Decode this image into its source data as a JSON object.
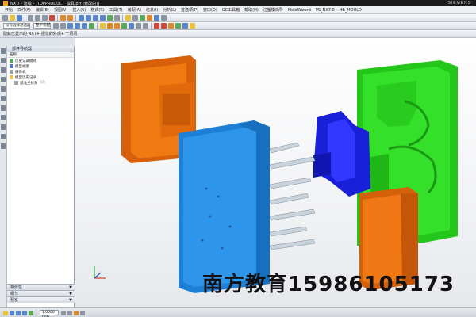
{
  "window": {
    "title": "NX 7 - 建模 - [TOPPRODUCT_模具.prt (修改的)]",
    "brand": "SIEMENS"
  },
  "menu": {
    "items": [
      "开始",
      "文件(F)",
      "编辑(E)",
      "视图(V)",
      "插入(S)",
      "格式(R)",
      "工具(T)",
      "装配(A)",
      "信息(I)",
      "分析(L)",
      "首选项(P)",
      "窗口(O)",
      "GC工具箱",
      "帮助(H)",
      "注塑模向导",
      "MoldWizard",
      "PS_NX7.0",
      "HB_MOULD"
    ]
  },
  "toolbar": {
    "filter_select": "没有选择过滤器",
    "assembly_select": "整个装配"
  },
  "breadcrumb": "隐藏已显示的 NX7+ 视觉的外观+ 一层层",
  "navigator": {
    "title": "部件导航器",
    "column_header": "名称",
    "items": [
      {
        "label": "历史记录模式",
        "level": 1,
        "icon": "history-mode-icon"
      },
      {
        "label": "模型视图",
        "level": 1,
        "icon": "model-views-icon"
      },
      {
        "label": "摄像机",
        "level": 1,
        "icon": "camera-icon"
      },
      {
        "label": "模型历史记录",
        "level": 1,
        "icon": "folder-icon"
      },
      {
        "label": "基准坐标系",
        "level": 2,
        "icon": "datum-csys-icon",
        "suffix": "(0)"
      }
    ],
    "footer_sections": [
      "相依性",
      "细节",
      "预览"
    ]
  },
  "watermark": "南方教育15986105173",
  "status": {
    "field": "1.0000 mm"
  },
  "colors": {
    "core_plate": "#2e8de0",
    "cavity_plate": "#29dd1f",
    "slider_orange": "#e5700f",
    "insert_blue": "#1b22dd"
  }
}
